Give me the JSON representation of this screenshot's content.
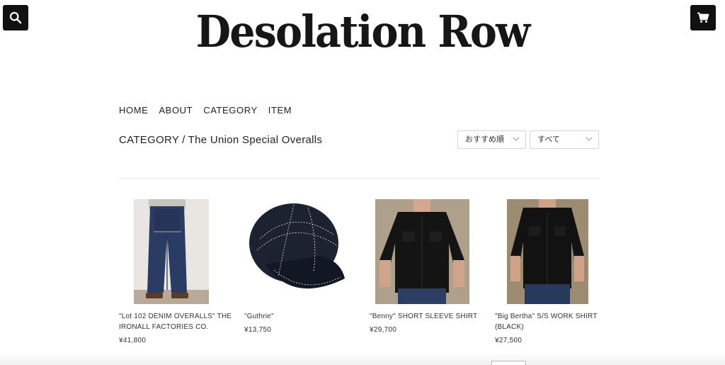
{
  "brand": {
    "logo_text": "Desolation Row"
  },
  "header": {
    "search_icon": "search-icon",
    "cart_icon": "cart-icon"
  },
  "nav": {
    "items": [
      "HOME",
      "ABOUT",
      "CATEGORY",
      "ITEM"
    ]
  },
  "page": {
    "heading_prefix": "CATEGORY",
    "heading_separator": "/",
    "heading_title": "The Union Special Overalls"
  },
  "filters": {
    "sort": {
      "selected": "おすすめ順",
      "icon": "chevron-down-icon"
    },
    "category": {
      "selected": "すべて",
      "icon": "chevron-down-icon"
    }
  },
  "products": [
    {
      "name": "\"Lot 102 DENIM OVERALLS\" THE IRONALL FACTORIES CO.",
      "price": "¥41,800"
    },
    {
      "name": "\"Guthrie\"",
      "price": "¥13,750"
    },
    {
      "name": "\"Benny\" SHORT SLEEVE SHIRT",
      "price": "¥29,700"
    },
    {
      "name": "\"Big Bertha\" S/S WORK SHIRT (BLACK)",
      "price": "¥27,500"
    }
  ],
  "colors": {
    "icon_bg": "#111111",
    "text": "#222222",
    "border": "#d4d4d4"
  }
}
